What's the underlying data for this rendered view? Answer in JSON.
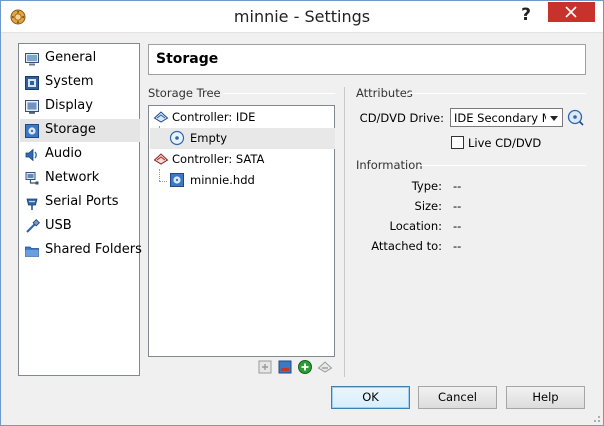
{
  "window": {
    "title": "minnie - Settings",
    "help_glyph": "?"
  },
  "sidebar": {
    "items": [
      {
        "label": "General",
        "icon": "general-icon",
        "selected": false
      },
      {
        "label": "System",
        "icon": "system-icon",
        "selected": false
      },
      {
        "label": "Display",
        "icon": "display-icon",
        "selected": false
      },
      {
        "label": "Storage",
        "icon": "storage-icon",
        "selected": true
      },
      {
        "label": "Audio",
        "icon": "audio-icon",
        "selected": false
      },
      {
        "label": "Network",
        "icon": "network-icon",
        "selected": false
      },
      {
        "label": "Serial Ports",
        "icon": "serial-ports-icon",
        "selected": false
      },
      {
        "label": "USB",
        "icon": "usb-icon",
        "selected": false
      },
      {
        "label": "Shared Folders",
        "icon": "shared-folders-icon",
        "selected": false
      }
    ]
  },
  "page": {
    "title": "Storage"
  },
  "storage_tree": {
    "heading": "Storage Tree",
    "controller_ide": "Controller: IDE",
    "ide_empty": "Empty",
    "controller_sata": "Controller: SATA",
    "sata_disk": "minnie.hdd",
    "selected": "Empty"
  },
  "attributes": {
    "heading": "Attributes",
    "cd_drive_label": "CD/DVD Drive:",
    "cd_drive_value": "IDE Secondary Ma",
    "live_cd_label": "Live CD/DVD",
    "live_cd_checked": false
  },
  "information": {
    "heading": "Information",
    "type_label": "Type:",
    "type_value": "--",
    "size_label": "Size:",
    "size_value": "--",
    "location_label": "Location:",
    "location_value": "--",
    "attached_label": "Attached to:",
    "attached_value": "--"
  },
  "buttons": {
    "ok": "OK",
    "cancel": "Cancel",
    "help": "Help"
  },
  "colors": {
    "close_red": "#c7332c",
    "selection_gray": "#e5e5e5",
    "default_button_border": "#3c7fb1"
  }
}
